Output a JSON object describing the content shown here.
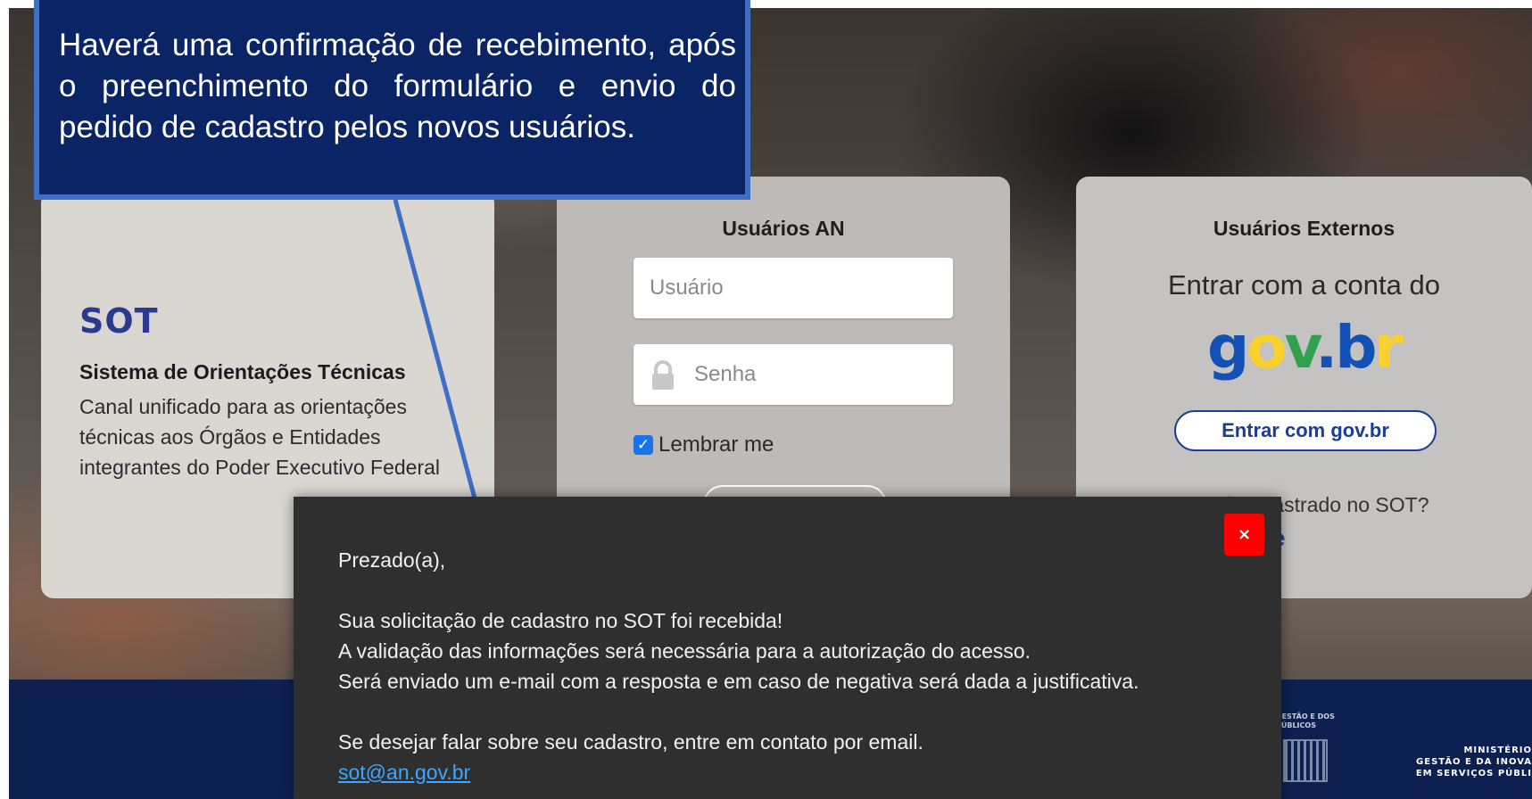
{
  "callout": {
    "text": "Haverá uma confirmação de recebimento, após o preenchimento do formulário e envio do pedido de cadastro pelos novos usuários."
  },
  "sot_card": {
    "title": "SOT",
    "subtitle": "Sistema de Orientações Técnicas",
    "description": "Canal unificado para as orientações técnicas aos Órgãos e Entidades integrantes do Poder Executivo Federal"
  },
  "an_card": {
    "heading": "Usuários AN",
    "username_placeholder": "Usuário",
    "password_placeholder": "Senha",
    "remember_label": "Lembrar me",
    "remember_checked": true
  },
  "external_card": {
    "heading": "Usuários Externos",
    "login_prompt": "Entrar com a conta do",
    "govbr_logo": "gov.br",
    "govbr_button": "Entrar com gov.br",
    "not_registered": "Não é cadastrado no SOT?",
    "partial_link": "e"
  },
  "modal": {
    "close_label": "×",
    "greeting": "Prezado(a),",
    "line1": "Sua solicitação de cadastro no SOT foi recebida!",
    "line2": "A validação das informações será necessária para a autorização do acesso.",
    "line3": "Será enviado um e-mail com a resposta e em caso de negativa será dada a justificativa.",
    "line4": "Se desejar falar sobre seu cadastro, entre em contato por email.",
    "email": "sot@an.gov.br"
  },
  "footer": {
    "logo1_text": "GESTÃO E DOS PÚBLICOS",
    "logo2_line1": "MINISTÉRIO",
    "logo2_line2": "GESTÃO E DA INOVA",
    "logo2_line3": "EM SERVIÇOS PÚBLI"
  },
  "colors": {
    "callout_bg": "#0a2465",
    "callout_border": "#3f6fc4",
    "footer_bg": "#0d2050",
    "modal_bg": "#2f2f2f",
    "close_button": "#ff0000",
    "sot_title": "#2b3a8f",
    "link": "#3ea6ff"
  }
}
